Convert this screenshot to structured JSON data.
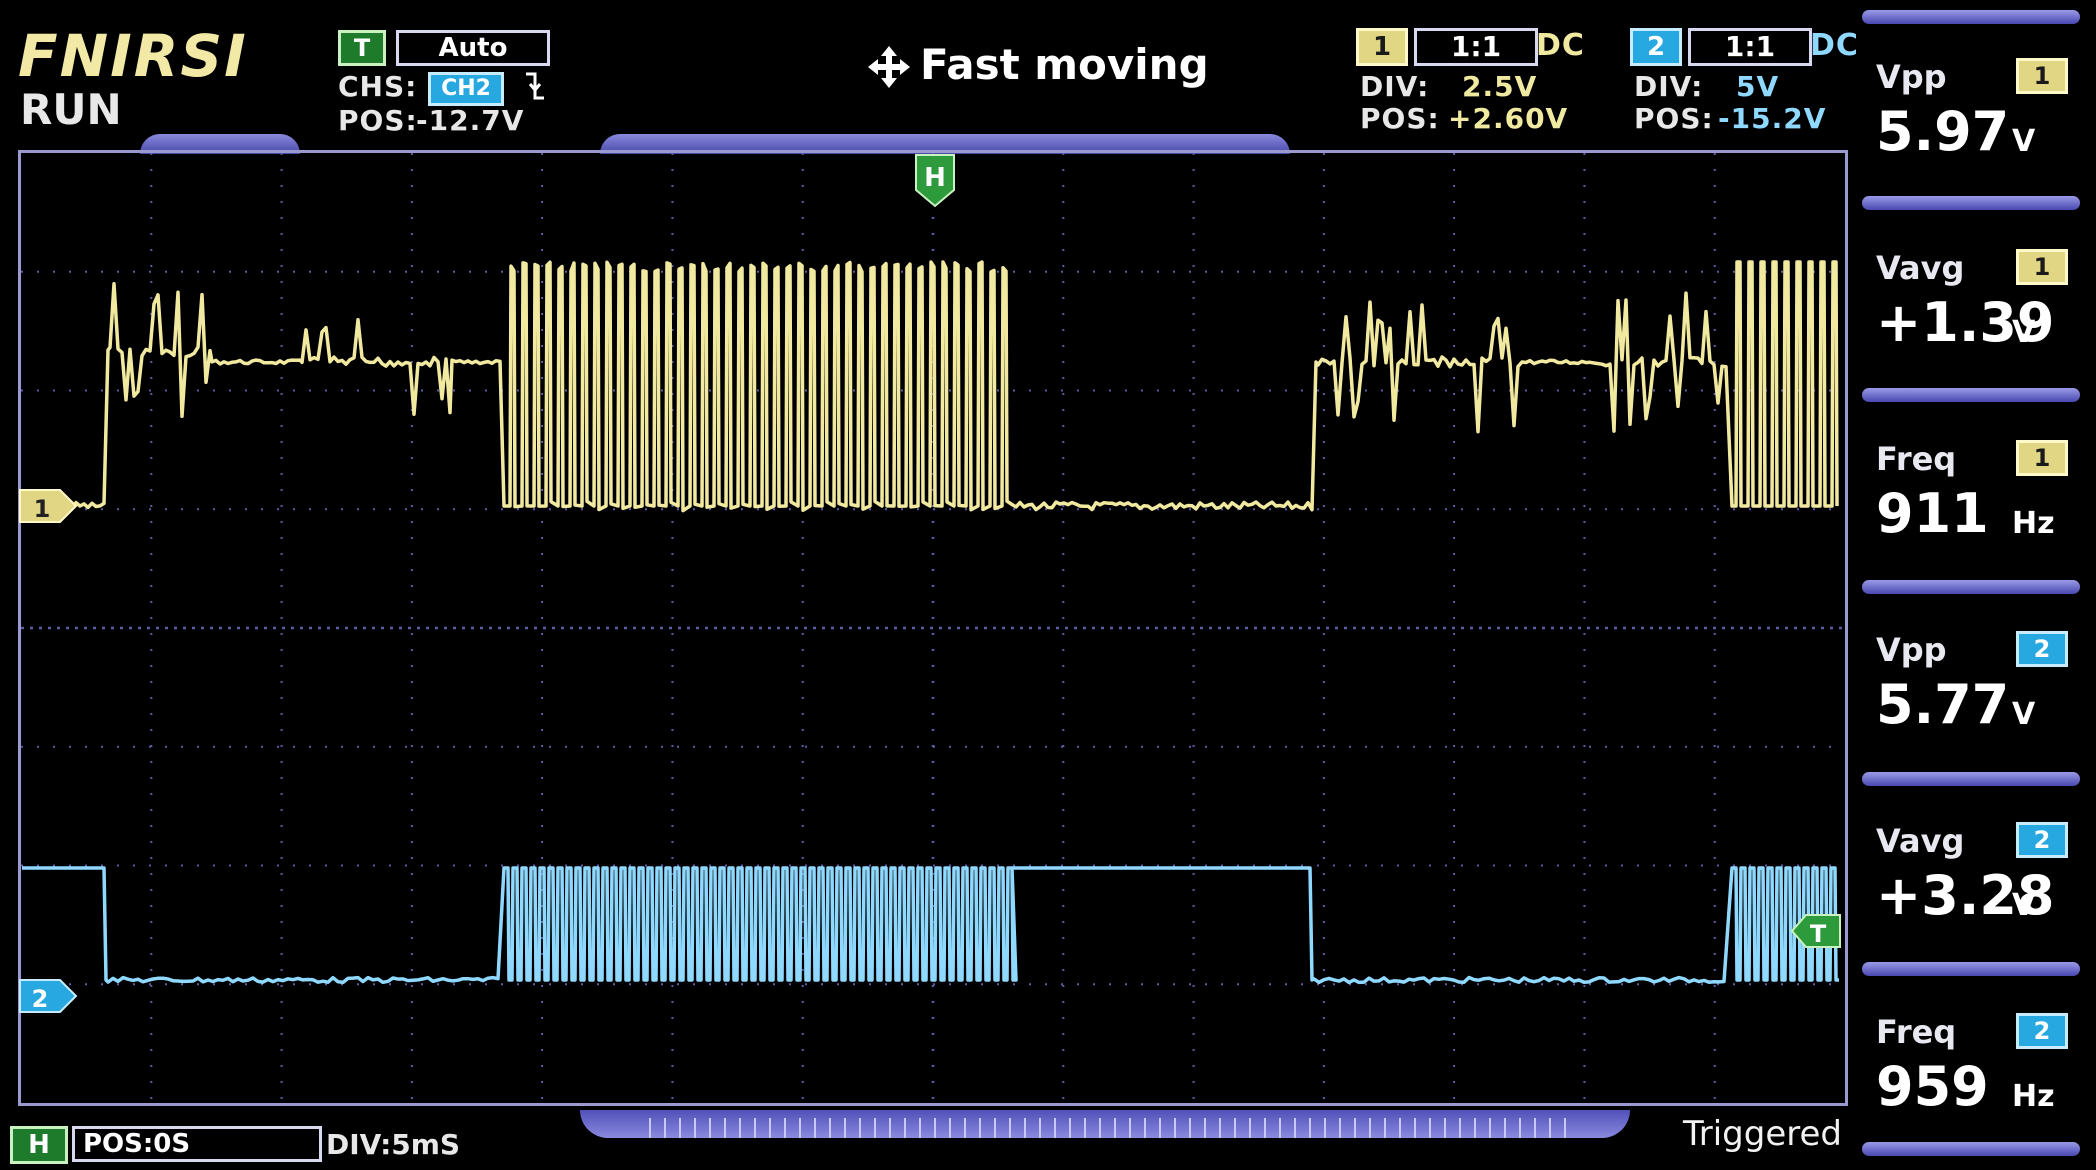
{
  "header": {
    "brand": "FNIRSI",
    "state": "RUN",
    "trigger": {
      "badge": "T",
      "mode": "Auto",
      "chs_label": "CHS:",
      "chs_value": "CH2",
      "pos_label": "POS:",
      "pos_value": "-12.7V"
    },
    "mode_text": "Fast moving",
    "ch1": {
      "badge": "1",
      "probe": "1:1",
      "coupling": "DC",
      "div_label": "DIV:",
      "div_value": "2.5V",
      "pos_label": "POS:",
      "pos_value": "+2.60V"
    },
    "ch2": {
      "badge": "2",
      "probe": "1:1",
      "coupling": "DC",
      "div_label": "DIV:",
      "div_value": "5V",
      "pos_label": "POS:",
      "pos_value": "-15.2V"
    }
  },
  "plot": {
    "h_marker": "H",
    "ch1_marker": "1",
    "ch2_marker": "2",
    "trigger_marker": "T"
  },
  "measurements": [
    {
      "label": "Vpp",
      "channel": "1",
      "value": "5.97",
      "unit": "V"
    },
    {
      "label": "Vavg",
      "channel": "1",
      "value": "+1.39",
      "unit": "V"
    },
    {
      "label": "Freq",
      "channel": "1",
      "value": "911",
      "unit": "Hz"
    },
    {
      "label": "Vpp",
      "channel": "2",
      "value": "5.77",
      "unit": "V"
    },
    {
      "label": "Vavg",
      "channel": "2",
      "value": "+3.28",
      "unit": "V"
    },
    {
      "label": "Freq",
      "channel": "2",
      "value": "959",
      "unit": "Hz"
    }
  ],
  "footer": {
    "h_badge": "H",
    "pos_text": "POS:0S",
    "div_text": "DIV:5mS",
    "status": "Triggered"
  },
  "colors": {
    "ch1": "#f2e9a0",
    "ch2": "#8fd8ff",
    "grid": "#5c5ca8",
    "frame": "#9a9ad0"
  }
}
